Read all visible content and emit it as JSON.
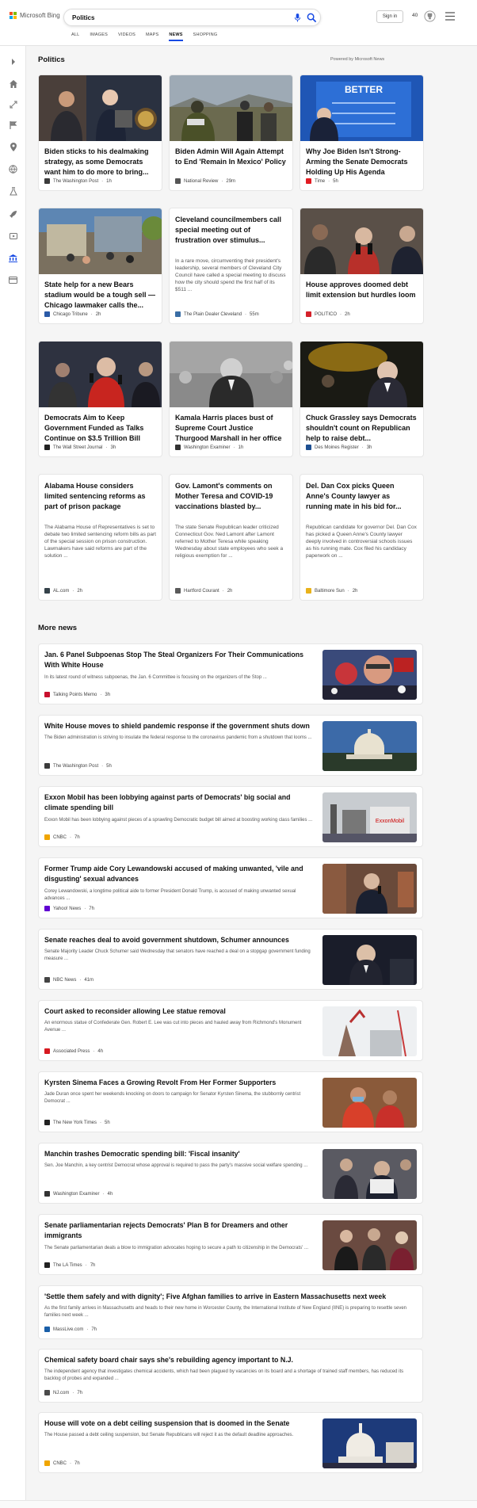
{
  "header": {
    "brand": "Microsoft Bing",
    "search_value": "Politics",
    "signin_label": "Sign in",
    "points": "40",
    "tabs": [
      {
        "label": "ALL"
      },
      {
        "label": "IMAGES"
      },
      {
        "label": "VIDEOS"
      },
      {
        "label": "MAPS"
      },
      {
        "label": "NEWS"
      },
      {
        "label": "SHOPPING"
      }
    ],
    "active_tab": "NEWS",
    "accent": "#174ae4"
  },
  "sidebar": {
    "icons": [
      "chevron-right-icon",
      "home-icon",
      "sports-icon",
      "flag-icon",
      "location-icon",
      "globe-icon",
      "science-icon",
      "rocket-icon",
      "entertainment-icon",
      "politics-icon",
      "money-icon"
    ]
  },
  "top": {
    "title": "Politics",
    "powered": "Powered by Microsoft News",
    "cards": [
      {
        "title": "Biden sticks to his dealmaking strategy, as some Democrats want him to do more to bring...",
        "source": "The Washington Post",
        "time": "1h",
        "fav": "#3b3b3b"
      },
      {
        "title": "Biden Admin Will Again Attempt to End 'Remain In Mexico' Policy",
        "source": "National Review",
        "time": "29m",
        "fav": "#555"
      },
      {
        "title": "Why Joe Biden Isn't Strong-Arming the Senate Democrats Holding Up His Agenda",
        "source": "Time",
        "time": "5h",
        "fav": "#e21b22"
      },
      {
        "title": "State help for a new Bears stadium would be a tough sell — Chicago lawmaker calls the...",
        "source": "Chicago Tribune",
        "time": "2h",
        "fav": "#2a5aa7"
      },
      {
        "title": "Cleveland councilmembers call special meeting out of frustration over stimulus...",
        "desc": "In a rare move, circumventing their president's leadership, several members of Cleveland City Council have called a special meeting to discuss how the city should spend the first half of its $511 ...",
        "source": "The Plain Dealer Cleveland",
        "time": "55m",
        "fav": "#3a6ea5"
      },
      {
        "title": "House approves doomed debt limit extension but hurdles loom",
        "source": "POLITICO",
        "time": "2h",
        "fav": "#d4212a"
      },
      {
        "title": "Democrats Aim to Keep Government Funded as Talks Continue on $3.5 Trillion Bill",
        "source": "The Wall Street Journal",
        "time": "3h",
        "fav": "#222"
      },
      {
        "title": "Kamala Harris places bust of Supreme Court Justice Thurgood Marshall in her office",
        "source": "Washington Examiner",
        "time": "1h",
        "fav": "#333"
      },
      {
        "title": "Chuck Grassley says Democrats shouldn't count on Republican help to raise debt...",
        "source": "Des Moines Register",
        "time": "3h",
        "fav": "#1d4f91"
      },
      {
        "title": "Alabama House considers limited sentencing reforms as part of prison package",
        "desc": "The Alabama House of Representatives is set to debate two limited sentencing reform bills as part of the special session on prison construction. Lawmakers have said reforms are part of the solution ...",
        "source": "AL.com",
        "time": "2h",
        "fav": "#35424a"
      },
      {
        "title": "Gov. Lamont's comments on Mother Teresa and COVID-19 vaccinations blasted by...",
        "desc": "The state Senate Republican leader criticized Connecticut Gov. Ned Lamont after Lamont referred to Mother Teresa while speaking Wednesday about state employees who seek a religious exemption for ...",
        "source": "Hartford Courant",
        "time": "2h",
        "fav": "#5a5a5a"
      },
      {
        "title": "Del. Dan Cox picks Queen Anne's County lawyer as running mate in his bid for...",
        "desc": "Republican candidate for governor Del. Dan Cox has picked a Queen Anne's County lawyer deeply involved in controversial schools issues as his running mate. Cox filed his candidacy paperwork on ...",
        "source": "Baltimore Sun",
        "time": "2h",
        "fav": "#e9b21b"
      }
    ]
  },
  "more": {
    "title": "More news",
    "items": [
      {
        "title": "Jan. 6 Panel Subpoenas Stop The Steal Organizers For Their Communications With White House",
        "desc": "In its latest round of witness subpoenas, the Jan. 6 Committee is focusing on the organizers of the Stop ...",
        "source": "Talking Points Memo",
        "time": "3h",
        "fav": "#c8102e"
      },
      {
        "title": "White House moves to shield pandemic response if the government shuts down",
        "desc": "The Biden administration is striving to insulate the federal response to the coronavirus pandemic from a shutdown that looms ...",
        "source": "The Washington Post",
        "time": "5h",
        "fav": "#3b3b3b"
      },
      {
        "title": "Exxon Mobil has been lobbying against parts of Democrats' big social and climate spending bill",
        "desc": "Exxon Mobil has been lobbying against pieces of a sprawling Democratic budget bill aimed at boosting working class families ...",
        "source": "CNBC",
        "time": "7h",
        "fav": "#f0a500"
      },
      {
        "title": "Former Trump aide Cory Lewandowski accused of making unwanted, 'vile and disgusting' sexual advances",
        "desc": "Corey Lewandowski, a longtime political aide to former President Donald Trump, is accused of making unwanted sexual advances ...",
        "source": "Yahoo! News",
        "time": "7h",
        "fav": "#6001d2"
      },
      {
        "title": "Senate reaches deal to avoid government shutdown, Schumer announces",
        "desc": "Senate Majority Leader Chuck Schumer said Wednesday that senators have reached a deal on a stopgap government funding measure ...",
        "source": "NBC News",
        "time": "41m",
        "fav": "#444"
      },
      {
        "title": "Court asked to reconsider allowing Lee statue removal",
        "desc": "An enormous statue of Confederate Gen. Robert E. Lee was cut into pieces and hauled away from Richmond's Monument Avenue ...",
        "source": "Associated Press",
        "time": "4h",
        "fav": "#d71920"
      },
      {
        "title": "Kyrsten Sinema Faces a Growing Revolt From Her Former Supporters",
        "desc": "Jade Duran once spent her weekends knocking on doors to campaign for Senator Kyrsten Sinema, the stubbornly centrist Democrat ...",
        "source": "The New York Times",
        "time": "5h",
        "fav": "#222"
      },
      {
        "title": "Manchin trashes Democratic spending bill: 'Fiscal insanity'",
        "desc": "Sen. Joe Manchin, a key centrist Democrat whose approval is required to pass the party's massive social welfare spending ...",
        "source": "Washington Examiner",
        "time": "4h",
        "fav": "#333"
      },
      {
        "title": "Senate parliamentarian rejects Democrats' Plan B for Dreamers and other immigrants",
        "desc": "The Senate parliamentarian deals a blow to immigration advocates hoping to secure a path to citizenship in the Democrats' ...",
        "source": "The LA Times",
        "time": "7h",
        "fav": "#222"
      },
      {
        "title": "'Settle them safely and with dignity'; Five Afghan families to arrive in Eastern Massachusetts next week",
        "desc": "As the first family arrives in Massachusetts and heads to their new home in Worcester County, the International Institute of New England (IINE) is preparing to resettle seven families next week ...",
        "source": "MassLive.com",
        "time": "7h",
        "fav": "#1a5fa8"
      },
      {
        "title": "Chemical safety board chair says she's rebuilding agency important to N.J.",
        "desc": "The independent agency that investigates chemical accidents, which had been plagued by vacancies on its board and a shortage of trained staff members, has reduced its backlog of probes and expanded ...",
        "source": "NJ.com",
        "time": "7h",
        "fav": "#4a4a4a"
      },
      {
        "title": "House will vote on a debt ceiling suspension that is doomed in the Senate",
        "desc": "The House passed a debt ceiling suspension, but Senate Republicans will reject it as the default deadline approaches.",
        "source": "CNBC",
        "time": "7h",
        "fav": "#f0a500"
      }
    ]
  }
}
